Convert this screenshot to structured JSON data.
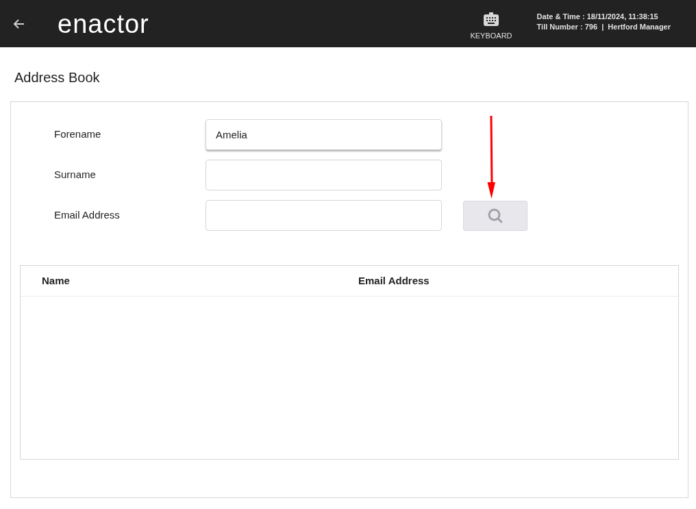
{
  "header": {
    "logo": "enactor",
    "keyboard_label": "KEYBOARD",
    "date_time": "Date & Time : 18/11/2024, 11:38:15",
    "till_info": "Till Number : 796  |  Hertford Manager"
  },
  "page_title": "Address Book",
  "fields": [
    {
      "label": "Forename",
      "value": "Amelia",
      "focused": true
    },
    {
      "label": "Surname",
      "focused": false
    },
    {
      "label": "Email Address",
      "focused": false
    }
  ],
  "table": {
    "columns": [
      "Name",
      "Email Address"
    ]
  }
}
